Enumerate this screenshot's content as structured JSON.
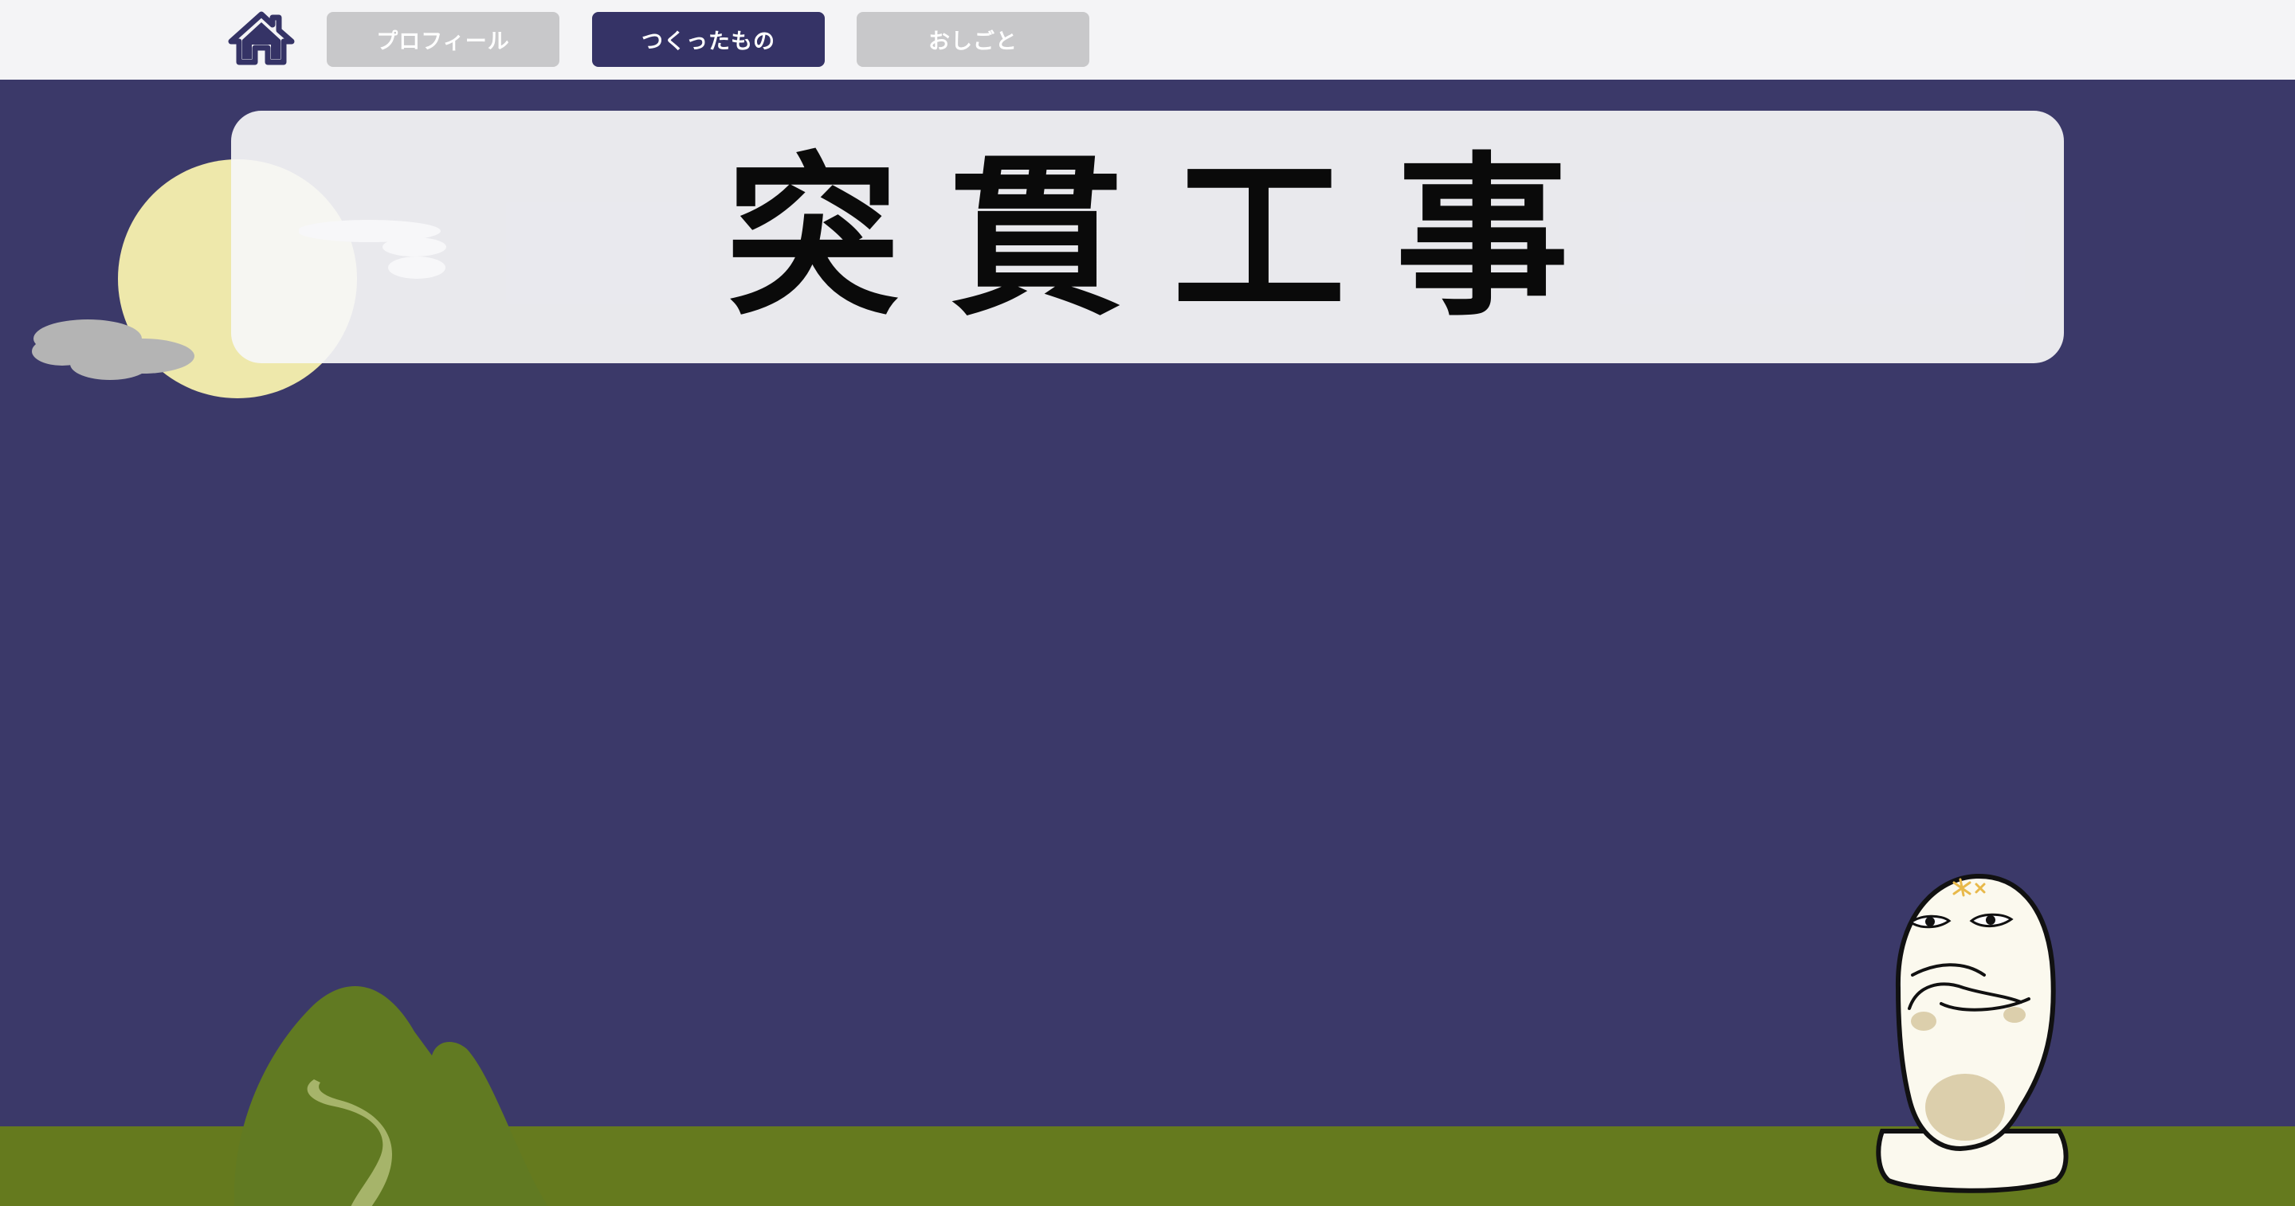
{
  "nav": {
    "home_icon": "home-icon",
    "tabs": [
      {
        "label": "プロフィール",
        "active": false
      },
      {
        "label": "つくったもの",
        "active": true
      },
      {
        "label": "おしごと",
        "active": false
      }
    ]
  },
  "main": {
    "title": "突貫工事"
  },
  "colors": {
    "background": "#3b3969",
    "nav_bar": "#f4f4f6",
    "tab_active": "#353366",
    "tab_inactive": "#c8c8ca",
    "moon": "#eee8ab",
    "ground": "#657a1e",
    "hill": "#617a22"
  },
  "decorations": [
    "moon",
    "grey-cloud",
    "white-cloud",
    "green-hill",
    "mascot-character"
  ]
}
